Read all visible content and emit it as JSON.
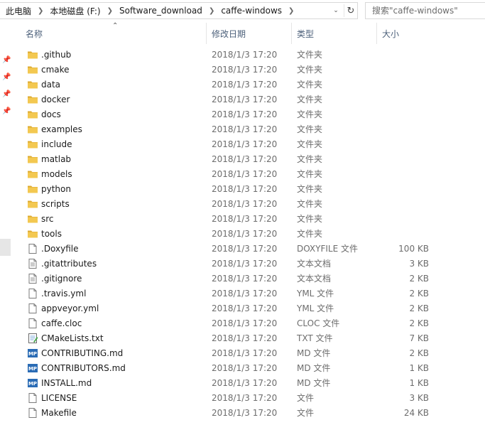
{
  "breadcrumb": [
    "此电脑",
    "本地磁盘 (F:)",
    "Software_download",
    "caffe-windows"
  ],
  "search": {
    "placeholder": "搜索\"caffe-windows\""
  },
  "columns": {
    "name": "名称",
    "date": "修改日期",
    "type": "类型",
    "size": "大小"
  },
  "colors": {
    "folder": "#f3c851",
    "folder_dark": "#dcaa2f",
    "mp_icon": "#2b6cb5",
    "header_text": "#4c607a"
  },
  "files": [
    {
      "name": ".github",
      "date": "2018/1/3 17:20",
      "type": "文件夹",
      "size": "",
      "icon": "folder-icon"
    },
    {
      "name": "cmake",
      "date": "2018/1/3 17:20",
      "type": "文件夹",
      "size": "",
      "icon": "folder-icon"
    },
    {
      "name": "data",
      "date": "2018/1/3 17:20",
      "type": "文件夹",
      "size": "",
      "icon": "folder-icon"
    },
    {
      "name": "docker",
      "date": "2018/1/3 17:20",
      "type": "文件夹",
      "size": "",
      "icon": "folder-icon"
    },
    {
      "name": "docs",
      "date": "2018/1/3 17:20",
      "type": "文件夹",
      "size": "",
      "icon": "folder-icon"
    },
    {
      "name": "examples",
      "date": "2018/1/3 17:20",
      "type": "文件夹",
      "size": "",
      "icon": "folder-icon"
    },
    {
      "name": "include",
      "date": "2018/1/3 17:20",
      "type": "文件夹",
      "size": "",
      "icon": "folder-icon"
    },
    {
      "name": "matlab",
      "date": "2018/1/3 17:20",
      "type": "文件夹",
      "size": "",
      "icon": "folder-icon"
    },
    {
      "name": "models",
      "date": "2018/1/3 17:20",
      "type": "文件夹",
      "size": "",
      "icon": "folder-icon"
    },
    {
      "name": "python",
      "date": "2018/1/3 17:20",
      "type": "文件夹",
      "size": "",
      "icon": "folder-icon"
    },
    {
      "name": "scripts",
      "date": "2018/1/3 17:20",
      "type": "文件夹",
      "size": "",
      "icon": "folder-icon"
    },
    {
      "name": "src",
      "date": "2018/1/3 17:20",
      "type": "文件夹",
      "size": "",
      "icon": "folder-icon"
    },
    {
      "name": "tools",
      "date": "2018/1/3 17:20",
      "type": "文件夹",
      "size": "",
      "icon": "folder-icon"
    },
    {
      "name": ".Doxyfile",
      "date": "2018/1/3 17:20",
      "type": "DOXYFILE 文件",
      "size": "100 KB",
      "icon": "file-icon"
    },
    {
      "name": ".gitattributes",
      "date": "2018/1/3 17:20",
      "type": "文本文档",
      "size": "3 KB",
      "icon": "text-file-icon"
    },
    {
      "name": ".gitignore",
      "date": "2018/1/3 17:20",
      "type": "文本文档",
      "size": "2 KB",
      "icon": "text-file-icon"
    },
    {
      "name": ".travis.yml",
      "date": "2018/1/3 17:20",
      "type": "YML 文件",
      "size": "2 KB",
      "icon": "file-icon"
    },
    {
      "name": "appveyor.yml",
      "date": "2018/1/3 17:20",
      "type": "YML 文件",
      "size": "2 KB",
      "icon": "file-icon"
    },
    {
      "name": "caffe.cloc",
      "date": "2018/1/3 17:20",
      "type": "CLOC 文件",
      "size": "2 KB",
      "icon": "file-icon"
    },
    {
      "name": "CMakeLists.txt",
      "date": "2018/1/3 17:20",
      "type": "TXT 文件",
      "size": "7 KB",
      "icon": "notepad-icon"
    },
    {
      "name": "CONTRIBUTING.md",
      "date": "2018/1/3 17:20",
      "type": "MD 文件",
      "size": "2 KB",
      "icon": "markdown-icon"
    },
    {
      "name": "CONTRIBUTORS.md",
      "date": "2018/1/3 17:20",
      "type": "MD 文件",
      "size": "1 KB",
      "icon": "markdown-icon"
    },
    {
      "name": "INSTALL.md",
      "date": "2018/1/3 17:20",
      "type": "MD 文件",
      "size": "1 KB",
      "icon": "markdown-icon"
    },
    {
      "name": "LICENSE",
      "date": "2018/1/3 17:20",
      "type": "文件",
      "size": "3 KB",
      "icon": "file-icon"
    },
    {
      "name": "Makefile",
      "date": "2018/1/3 17:20",
      "type": "文件",
      "size": "24 KB",
      "icon": "file-icon"
    }
  ]
}
